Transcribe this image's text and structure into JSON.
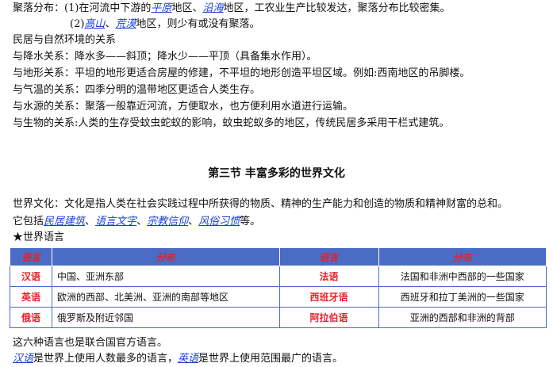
{
  "settlement": {
    "l1_a": "聚落分布：(1)在河流中下游的",
    "l1_k1": "平原",
    "l1_b": "地区、",
    "l1_k2": "沿海",
    "l1_c": "地区，工农业生产比较发达，聚落分布比较密集。",
    "l2_a": "(2)",
    "l2_k1": "高山",
    "l2_b": "、",
    "l2_k2": "荒漠",
    "l2_c": "地区，则少有或没有聚落。"
  },
  "relations": {
    "heading": "民居与自然环境的关系",
    "rain": "与降水关系：降水多——斜顶；降水少——平顶（具备集水作用）。",
    "terrain": "与地形关系：平坦的地形更适合房屋的修建，不平坦的地形创造平坦区域。例如:西南地区的吊脚楼。",
    "temperature": "与气温的关系：四季分明的温带地区更适合人类生存。",
    "water": "与水源的关系：聚落一般靠近河流，方便取水，也方便利用水道进行运输。",
    "biology": "与生物的关系:人类的生存受蚊虫蛇蚁的影响，蚊虫蛇蚁多的地区，传统民居多采用干栏式建筑。"
  },
  "section": {
    "title": "第三节   丰富多彩的世界文化",
    "def": "世界文化：文化是指人类在社会实践过程中所获得的物质、精神的生产能力和创造的物质和精神财富的总和。",
    "incl_a": "它包括",
    "incl_k1": "民居建筑",
    "incl_s1": "、",
    "incl_k2": "语言文字",
    "incl_s2": "、",
    "incl_k3": "宗教信仰",
    "incl_s3": "、",
    "incl_k4": "风俗习惯",
    "incl_b": "等。",
    "lang_heading": "★世界语言"
  },
  "table": {
    "h_lang": "语言",
    "h_region": "分布",
    "rows": [
      {
        "l1": "汉语",
        "r1": "中国、亚洲东部",
        "l2": "法语",
        "r2": "法国和非洲中西部的一些国家"
      },
      {
        "l1": "英语",
        "r1": "欧洲的西部、北美洲、亚洲的南部等地区",
        "l2": "西班牙语",
        "r2": "西班牙和拉丁美洲的一些国家"
      },
      {
        "l1": "俄语",
        "r1": "俄罗斯及附近邻国",
        "l2": "阿拉伯语",
        "r2": "亚洲的西部和非洲的背部"
      }
    ]
  },
  "footer": {
    "l1": "这六种语言也是联合国官方语言。",
    "k1": "汉语",
    "t1": "是世界上使用人数最多的语言，",
    "k2": "英语",
    "t2": "是世界上使用范围最广的语言。"
  },
  "colors": {
    "link": "#1a3fd6",
    "red": "#e8202a",
    "table_header": "#4a6cc4"
  }
}
